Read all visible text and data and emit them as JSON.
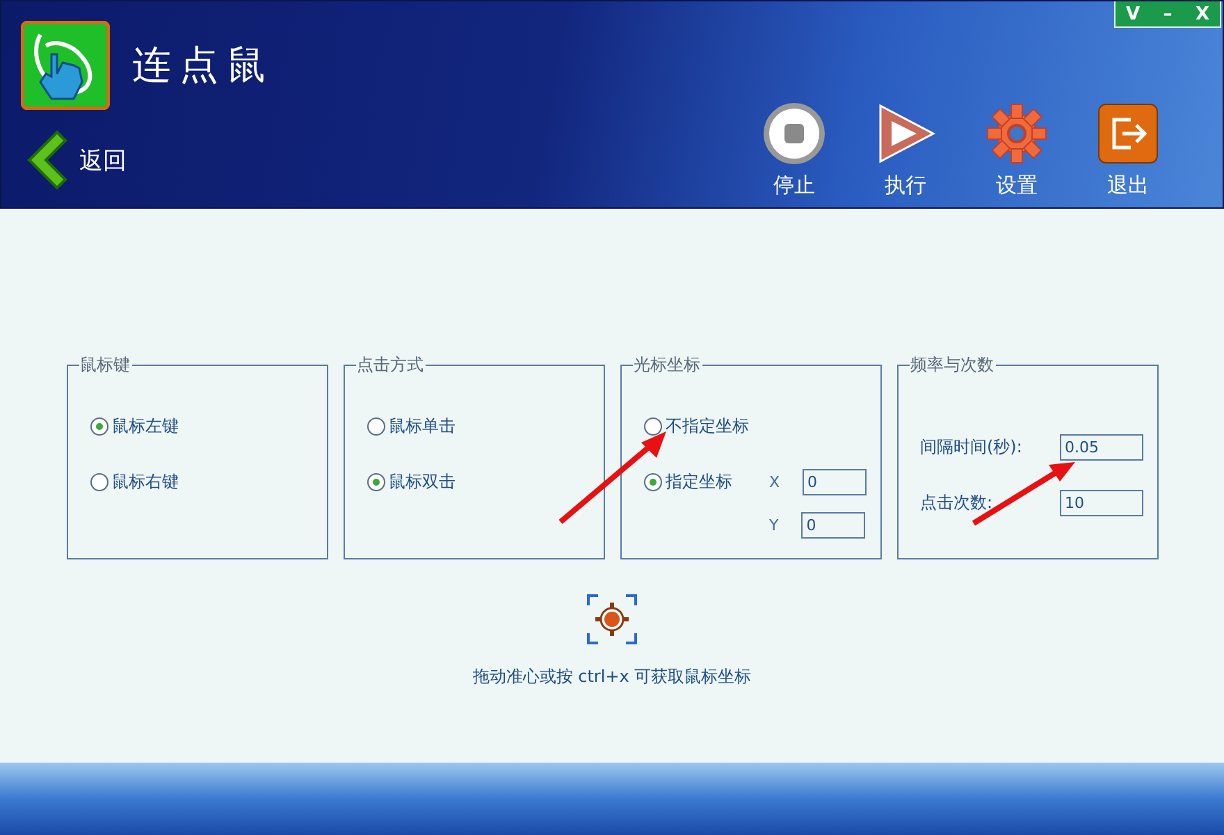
{
  "window_controls": [
    "V",
    "–",
    "X"
  ],
  "app_title": "连点鼠",
  "back_label": "返回",
  "toolbar": [
    {
      "kind": "stop",
      "label": "停止"
    },
    {
      "kind": "play",
      "label": "执行"
    },
    {
      "kind": "gear",
      "label": "设置"
    },
    {
      "kind": "exit",
      "label": "退出"
    }
  ],
  "groups": [
    {
      "kind": "radio",
      "title": "鼠标键",
      "options": [
        {
          "label": "鼠标左键",
          "selected": true
        },
        {
          "label": "鼠标右键",
          "selected": false
        }
      ]
    },
    {
      "kind": "radio",
      "title": "点击方式",
      "options": [
        {
          "label": "鼠标单击",
          "selected": false
        },
        {
          "label": "鼠标双击",
          "selected": true
        }
      ]
    },
    {
      "kind": "coords",
      "title": "光标坐标",
      "options": [
        {
          "label": "不指定坐标",
          "selected": false
        },
        {
          "label": "指定坐标",
          "selected": true
        }
      ],
      "fields": [
        {
          "label": "X",
          "value": "0"
        },
        {
          "label": "Y",
          "value": "0"
        }
      ]
    },
    {
      "kind": "fields",
      "title": "频率与次数",
      "fields": [
        {
          "label": "间隔时间(秒):",
          "value": "0.05"
        },
        {
          "label": "点击次数:",
          "value": "10"
        }
      ]
    }
  ],
  "hint": "拖动准心或按 ctrl+x 可获取鼠标坐标"
}
